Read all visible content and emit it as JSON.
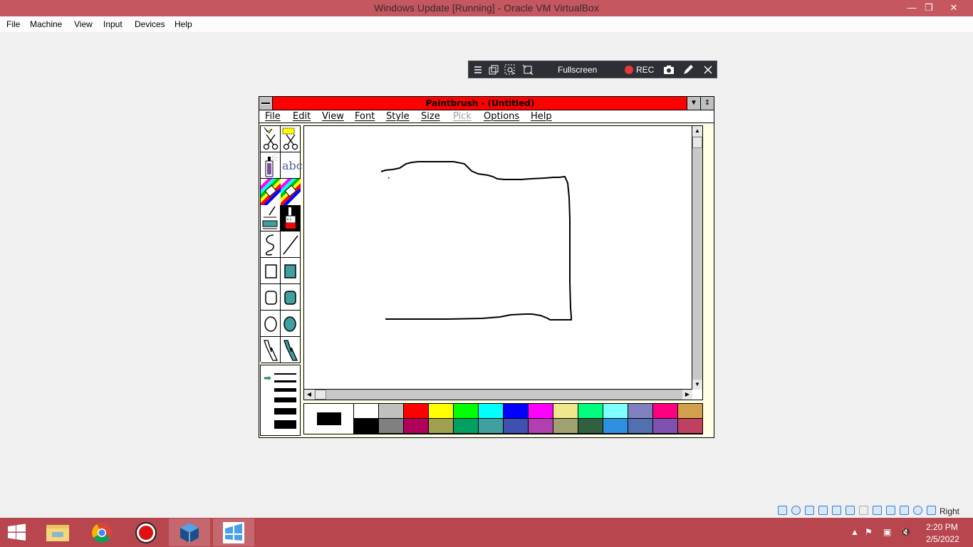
{
  "host": {
    "title": "Windows Update [Running] - Oracle VM VirtualBox",
    "window_controls": {
      "minimize": "—",
      "restore": "❐",
      "close": "✕"
    },
    "menu": [
      "File",
      "Machine",
      "View",
      "Input",
      "Devices",
      "Help"
    ]
  },
  "mini_toolbar": {
    "fullscreen_label": "Fullscreen",
    "rec_label": "REC",
    "icons": [
      "menu-icon",
      "windows-icon",
      "zoom-icon",
      "resize-icon",
      "camera-icon",
      "pen-icon",
      "close-icon"
    ]
  },
  "paintbrush": {
    "title": "Paintbrush - (Untitled)",
    "title_buttons": {
      "minimize": "▼",
      "maximize": "⇕"
    },
    "menu": [
      {
        "label": "File",
        "enabled": true
      },
      {
        "label": "Edit",
        "enabled": true
      },
      {
        "label": "View",
        "enabled": true
      },
      {
        "label": "Font",
        "enabled": true
      },
      {
        "label": "Style",
        "enabled": true
      },
      {
        "label": "Size",
        "enabled": true
      },
      {
        "label": "Pick",
        "enabled": false
      },
      {
        "label": "Options",
        "enabled": true
      },
      {
        "label": "Help",
        "enabled": true
      }
    ],
    "tools": [
      "scissors-pick-icon",
      "scissors-icon",
      "airbrush-icon",
      "text-tool-icon",
      "color-eraser-icon",
      "eraser-icon",
      "paint-roller-icon",
      "brush-icon",
      "curve-icon",
      "line-icon",
      "box-icon",
      "filled-box-icon",
      "rounded-box-icon",
      "filled-rounded-box-icon",
      "circle-icon",
      "filled-circle-icon",
      "polygon-icon",
      "filled-polygon-icon"
    ],
    "selected_tool": "brush-icon",
    "text_tool_label": "abc",
    "line_sizes": 6,
    "selected_line_size_index": 0,
    "foreground_color": "#000000",
    "background_color": "#ffffff",
    "palette_top": [
      "#ffffff",
      "#c0c0c0",
      "#ff0000",
      "#ffff00",
      "#00ff00",
      "#00ffff",
      "#0000ff",
      "#ff00ff",
      "#f0e68c",
      "#00ff7f",
      "#80ffff",
      "#8080c0",
      "#ff0080",
      "#d2a04a"
    ],
    "palette_bottom": [
      "#000000",
      "#808080",
      "#b0005a",
      "#a0a050",
      "#00a060",
      "#40a0a0",
      "#4050b0",
      "#b040b0",
      "#a0a070",
      "#306040",
      "#3090e0",
      "#5070b0",
      "#8050b0",
      "#c04060"
    ]
  },
  "status_bar": {
    "host_key": "Right Ctrl"
  },
  "taskbar": {
    "apps": [
      "start-icon",
      "file-explorer-icon",
      "chrome-icon",
      "recorder-icon",
      "virtualbox-icon",
      "windows-vm-icon"
    ],
    "time": "2:20 PM",
    "date": "2/5/2022"
  }
}
